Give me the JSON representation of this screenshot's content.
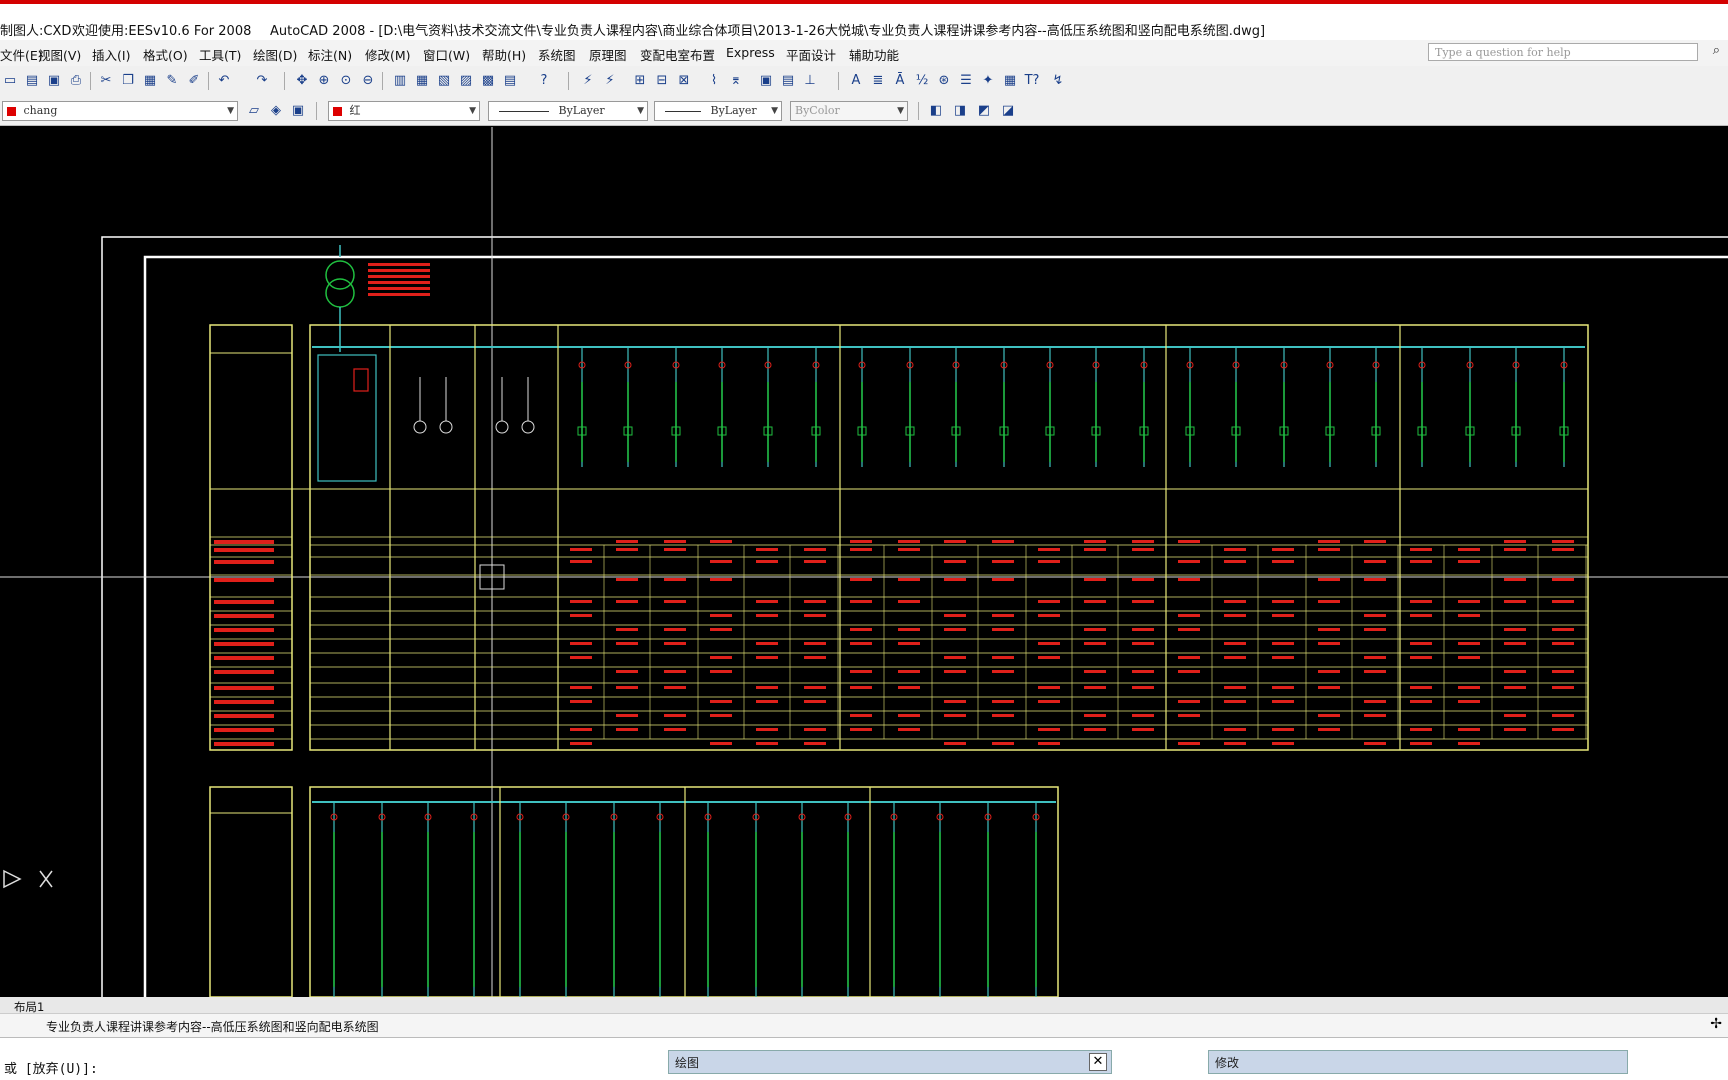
{
  "titlebar": {
    "user": "制图人:CXD",
    "welcome": "欢迎使用:EESv10.6 For 2008",
    "title": "AutoCAD 2008 - [D:\\电气资料\\技术交流文件\\专业负责人课程内容\\商业综合体项目\\2013-1-26大悦城\\专业负责人课程讲课参考内容--高低压系统图和竖向配电系统图.dwg]"
  },
  "menubar": {
    "items": [
      "文件(E)",
      "视图(V)",
      "插入(I)",
      "格式(O)",
      "工具(T)",
      "绘图(D)",
      "标注(N)",
      "修改(M)",
      "窗口(W)",
      "帮助(H)",
      "系统图",
      "原理图",
      "变配电室布置",
      "Express",
      "平面设计",
      "辅助功能"
    ],
    "help_placeholder": "Type a question for help"
  },
  "toolbar2": {
    "layer": "chang",
    "color": "红",
    "linetype": "ByLayer",
    "lineweight": "ByLayer",
    "plotstyle": "ByColor"
  },
  "layout_tabs": [
    "布局1"
  ],
  "doc_title": "专业负责人课程讲课参考内容--高低压系统图和竖向配电系统图",
  "command_line": "或 [放弃(U)]:",
  "panels": {
    "draw": "绘图",
    "modify": "修改"
  },
  "colors": {
    "canvas": "#000000",
    "frame": "#ffffff",
    "table": "#e8e87a",
    "bus": "#3fc0c0",
    "feeder": "#20c040",
    "text": "#e0201a"
  }
}
